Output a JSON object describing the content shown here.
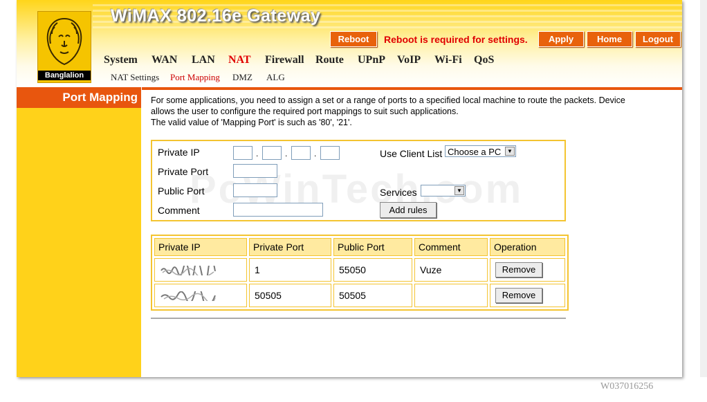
{
  "header": {
    "title": "WiMAX 802.16e Gateway",
    "logo_text": "Banglalion",
    "reboot_label": "Reboot",
    "reboot_note": "Reboot is required for settings.",
    "apply_label": "Apply",
    "home_label": "Home",
    "logout_label": "Logout"
  },
  "nav": {
    "items": [
      "System",
      "WAN",
      "LAN",
      "NAT",
      "Firewall",
      "Route",
      "UPnP",
      "VoIP",
      "Wi-Fi",
      "QoS"
    ],
    "active": "NAT"
  },
  "subnav": {
    "items": [
      "NAT Settings",
      "Port Mapping",
      "DMZ",
      "ALG"
    ],
    "active": "Port Mapping"
  },
  "sidebar": {
    "title": "Port Mapping"
  },
  "intro": {
    "line1": "For some applications, you need to assign a set or a range of ports to a specified local machine to route the packets. Device",
    "line2": "allows the user to configure the required port mappings to suit such applications.",
    "line3": "The valid value of 'Mapping Port' is such as '80', '21'."
  },
  "form": {
    "private_ip_label": "Private IP",
    "private_port_label": "Private Port",
    "public_port_label": "Public Port",
    "comment_label": "Comment",
    "use_client_list_label": "Use Client List",
    "client_select_value": "Choose a PC",
    "services_label": "Services",
    "services_value": "",
    "add_rules_label": "Add rules"
  },
  "table": {
    "headers": [
      "Private IP",
      "Private Port",
      "Public Port",
      "Comment",
      "Operation"
    ],
    "rows": [
      {
        "private_port": "1",
        "public_port": "55050",
        "comment": "Vuze",
        "action": "Remove"
      },
      {
        "private_port": "50505",
        "public_port": "50505",
        "comment": "",
        "action": "Remove"
      }
    ]
  },
  "watermark": "PcWinTech.com",
  "serial": "W037016256",
  "colors": {
    "accent_orange": "#e8560e",
    "sidebar_yellow": "#ffd21a",
    "alert_red": "#e00000",
    "table_border": "#f4c430"
  }
}
